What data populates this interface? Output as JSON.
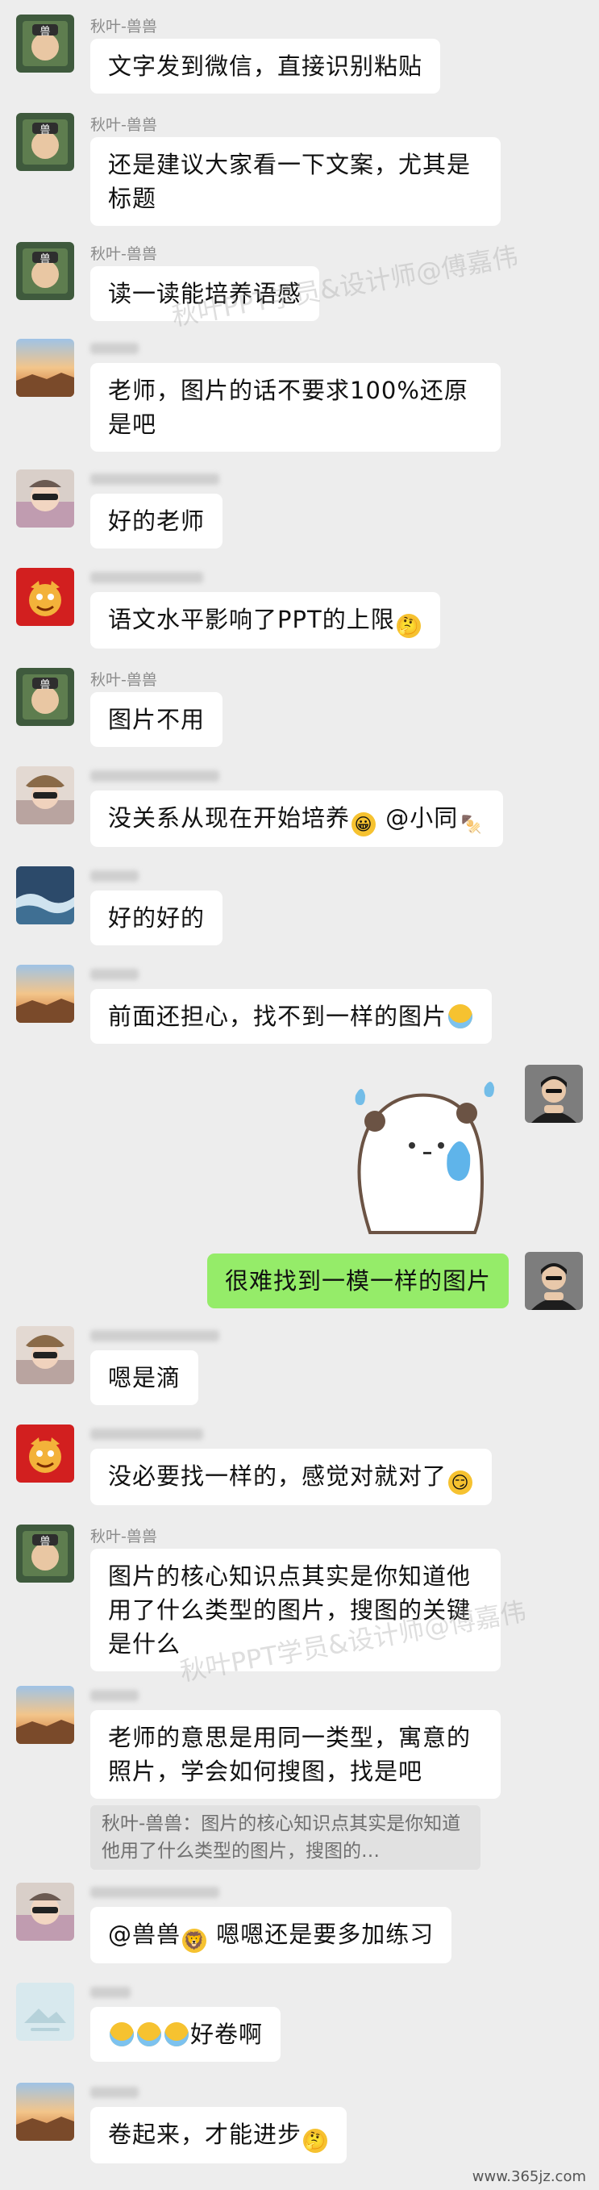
{
  "colors": {
    "background": "#ededed",
    "bubble_other": "#ffffff",
    "bubble_self": "#95ec69"
  },
  "messages": [
    {
      "sender": "秋叶-兽兽",
      "text": "文字发到微信，直接识别粘贴"
    },
    {
      "sender": "秋叶-兽兽",
      "text": "还是建议大家看一下文案，尤其是标题"
    },
    {
      "sender": "秋叶-兽兽",
      "text": "读一读能培养语感"
    },
    {
      "sender": "",
      "text": "老师，图片的话不要求100%还原是吧"
    },
    {
      "sender": "",
      "text": "好的老师"
    },
    {
      "sender": "",
      "text": "语文水平影响了PPT的上限"
    },
    {
      "sender": "秋叶-兽兽",
      "text": "图片不用"
    },
    {
      "sender": "",
      "text": "没关系从现在开始培养",
      "mention": "@小同"
    },
    {
      "sender": "",
      "text": "好的好的"
    },
    {
      "sender": "",
      "text": "前面还担心，找不到一样的图片"
    },
    {
      "sender": "",
      "text": "很难找到一模一样的图片",
      "self": true
    },
    {
      "sender": "",
      "text": "嗯是滴"
    },
    {
      "sender": "",
      "text": "没必要找一样的，感觉对就对了"
    },
    {
      "sender": "秋叶-兽兽",
      "text": "图片的核心知识点其实是你知道他用了什么类型的图片，搜图的关键是什么"
    },
    {
      "sender": "",
      "text": "老师的意思是用同一类型，寓意的照片，学会如何搜图，找是吧",
      "quote": "秋叶-兽兽：图片的核心知识点其实是你知道他用了什么类型的图片，搜图的…"
    },
    {
      "sender": "",
      "mention": "@兽兽",
      "text": "嗯嗯还是要多加练习"
    },
    {
      "sender": "",
      "text": "好卷啊"
    },
    {
      "sender": "",
      "text": "卷起来，才能进步"
    }
  ],
  "watermark": "秋叶PPT学员&设计师@傅嘉伟",
  "site_url": "www.365jz.com"
}
